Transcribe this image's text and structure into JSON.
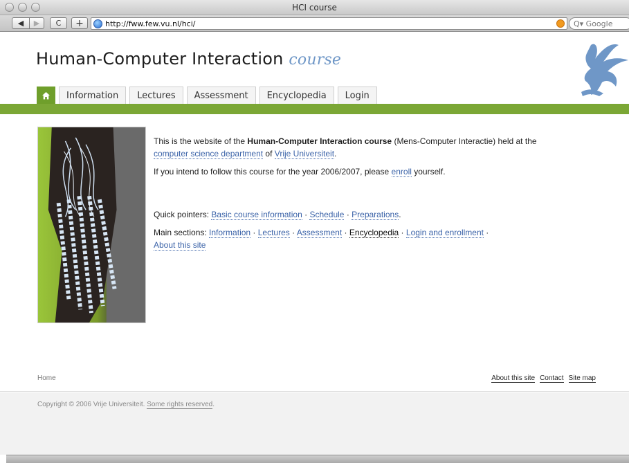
{
  "window": {
    "title": "HCI course"
  },
  "toolbar": {
    "back_icon": "◀",
    "forward_icon": "▶",
    "reload_icon": "C",
    "add_icon": "+",
    "url": "http://fww.few.vu.nl/hci/",
    "search_placeholder": "Q▾ Google"
  },
  "header": {
    "title_main": "Human-Computer Interaction ",
    "title_sub": "course"
  },
  "tabs": {
    "home_icon": "⌂",
    "items": [
      "Information",
      "Lectures",
      "Assessment",
      "Encyclopedia",
      "Login"
    ]
  },
  "content": {
    "p1_a": "This is the website of the ",
    "p1_bold": "Human-Computer Interaction course",
    "p1_b": " (Mens-Computer Interactie) held at the ",
    "p1_link1": "computer science department",
    "p1_c": " of ",
    "p1_link2": "Vrije Universiteit",
    "p1_d": ".",
    "p2_a": "If you intend to follow this course for the year 2006/2007, please ",
    "p2_link": "enroll",
    "p2_b": " yourself.",
    "qp_label": "Quick pointers: ",
    "qp_links": [
      "Basic course information",
      "Schedule",
      "Preparations"
    ],
    "ms_label": "Main sections: ",
    "ms_links": [
      "Information",
      "Lectures",
      "Assessment",
      "Encyclopedia",
      "Login and enrollment",
      "About this site"
    ],
    "sep": " · "
  },
  "footer": {
    "breadcrumb": "Home",
    "links": [
      "About this site",
      "Contact",
      "Site map"
    ],
    "copyright_text": "Copyright © 2006 Vrije Universiteit. ",
    "copyright_link": "Some rights reserved",
    "copyright_end": "."
  },
  "colors": {
    "accent_green": "#7ba735",
    "link_blue": "#3b63a8",
    "title_blue": "#6f97c7"
  }
}
